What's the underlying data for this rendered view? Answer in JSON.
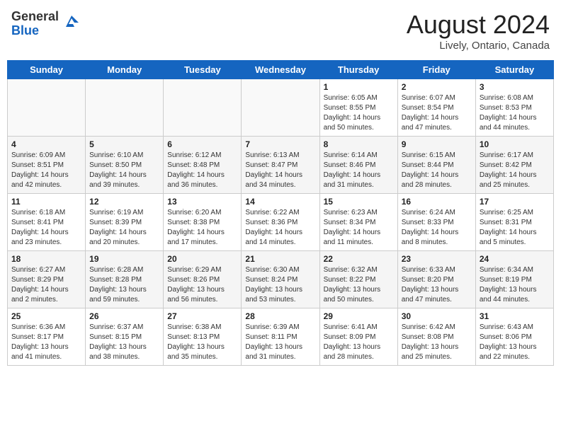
{
  "header": {
    "logo_general": "General",
    "logo_blue": "Blue",
    "title": "August 2024",
    "location": "Lively, Ontario, Canada"
  },
  "weekdays": [
    "Sunday",
    "Monday",
    "Tuesday",
    "Wednesday",
    "Thursday",
    "Friday",
    "Saturday"
  ],
  "weeks": [
    [
      {
        "day": "",
        "info": ""
      },
      {
        "day": "",
        "info": ""
      },
      {
        "day": "",
        "info": ""
      },
      {
        "day": "",
        "info": ""
      },
      {
        "day": "1",
        "info": "Sunrise: 6:05 AM\nSunset: 8:55 PM\nDaylight: 14 hours\nand 50 minutes."
      },
      {
        "day": "2",
        "info": "Sunrise: 6:07 AM\nSunset: 8:54 PM\nDaylight: 14 hours\nand 47 minutes."
      },
      {
        "day": "3",
        "info": "Sunrise: 6:08 AM\nSunset: 8:53 PM\nDaylight: 14 hours\nand 44 minutes."
      }
    ],
    [
      {
        "day": "4",
        "info": "Sunrise: 6:09 AM\nSunset: 8:51 PM\nDaylight: 14 hours\nand 42 minutes."
      },
      {
        "day": "5",
        "info": "Sunrise: 6:10 AM\nSunset: 8:50 PM\nDaylight: 14 hours\nand 39 minutes."
      },
      {
        "day": "6",
        "info": "Sunrise: 6:12 AM\nSunset: 8:48 PM\nDaylight: 14 hours\nand 36 minutes."
      },
      {
        "day": "7",
        "info": "Sunrise: 6:13 AM\nSunset: 8:47 PM\nDaylight: 14 hours\nand 34 minutes."
      },
      {
        "day": "8",
        "info": "Sunrise: 6:14 AM\nSunset: 8:46 PM\nDaylight: 14 hours\nand 31 minutes."
      },
      {
        "day": "9",
        "info": "Sunrise: 6:15 AM\nSunset: 8:44 PM\nDaylight: 14 hours\nand 28 minutes."
      },
      {
        "day": "10",
        "info": "Sunrise: 6:17 AM\nSunset: 8:42 PM\nDaylight: 14 hours\nand 25 minutes."
      }
    ],
    [
      {
        "day": "11",
        "info": "Sunrise: 6:18 AM\nSunset: 8:41 PM\nDaylight: 14 hours\nand 23 minutes."
      },
      {
        "day": "12",
        "info": "Sunrise: 6:19 AM\nSunset: 8:39 PM\nDaylight: 14 hours\nand 20 minutes."
      },
      {
        "day": "13",
        "info": "Sunrise: 6:20 AM\nSunset: 8:38 PM\nDaylight: 14 hours\nand 17 minutes."
      },
      {
        "day": "14",
        "info": "Sunrise: 6:22 AM\nSunset: 8:36 PM\nDaylight: 14 hours\nand 14 minutes."
      },
      {
        "day": "15",
        "info": "Sunrise: 6:23 AM\nSunset: 8:34 PM\nDaylight: 14 hours\nand 11 minutes."
      },
      {
        "day": "16",
        "info": "Sunrise: 6:24 AM\nSunset: 8:33 PM\nDaylight: 14 hours\nand 8 minutes."
      },
      {
        "day": "17",
        "info": "Sunrise: 6:25 AM\nSunset: 8:31 PM\nDaylight: 14 hours\nand 5 minutes."
      }
    ],
    [
      {
        "day": "18",
        "info": "Sunrise: 6:27 AM\nSunset: 8:29 PM\nDaylight: 14 hours\nand 2 minutes."
      },
      {
        "day": "19",
        "info": "Sunrise: 6:28 AM\nSunset: 8:28 PM\nDaylight: 13 hours\nand 59 minutes."
      },
      {
        "day": "20",
        "info": "Sunrise: 6:29 AM\nSunset: 8:26 PM\nDaylight: 13 hours\nand 56 minutes."
      },
      {
        "day": "21",
        "info": "Sunrise: 6:30 AM\nSunset: 8:24 PM\nDaylight: 13 hours\nand 53 minutes."
      },
      {
        "day": "22",
        "info": "Sunrise: 6:32 AM\nSunset: 8:22 PM\nDaylight: 13 hours\nand 50 minutes."
      },
      {
        "day": "23",
        "info": "Sunrise: 6:33 AM\nSunset: 8:20 PM\nDaylight: 13 hours\nand 47 minutes."
      },
      {
        "day": "24",
        "info": "Sunrise: 6:34 AM\nSunset: 8:19 PM\nDaylight: 13 hours\nand 44 minutes."
      }
    ],
    [
      {
        "day": "25",
        "info": "Sunrise: 6:36 AM\nSunset: 8:17 PM\nDaylight: 13 hours\nand 41 minutes."
      },
      {
        "day": "26",
        "info": "Sunrise: 6:37 AM\nSunset: 8:15 PM\nDaylight: 13 hours\nand 38 minutes."
      },
      {
        "day": "27",
        "info": "Sunrise: 6:38 AM\nSunset: 8:13 PM\nDaylight: 13 hours\nand 35 minutes."
      },
      {
        "day": "28",
        "info": "Sunrise: 6:39 AM\nSunset: 8:11 PM\nDaylight: 13 hours\nand 31 minutes."
      },
      {
        "day": "29",
        "info": "Sunrise: 6:41 AM\nSunset: 8:09 PM\nDaylight: 13 hours\nand 28 minutes."
      },
      {
        "day": "30",
        "info": "Sunrise: 6:42 AM\nSunset: 8:08 PM\nDaylight: 13 hours\nand 25 minutes."
      },
      {
        "day": "31",
        "info": "Sunrise: 6:43 AM\nSunset: 8:06 PM\nDaylight: 13 hours\nand 22 minutes."
      }
    ]
  ]
}
